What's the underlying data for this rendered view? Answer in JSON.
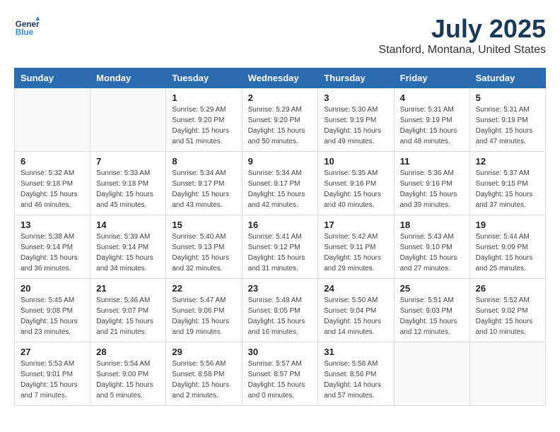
{
  "header": {
    "logo_line1": "General",
    "logo_line2": "Blue",
    "month_year": "July 2025",
    "location": "Stanford, Montana, United States"
  },
  "days_of_week": [
    "Sunday",
    "Monday",
    "Tuesday",
    "Wednesday",
    "Thursday",
    "Friday",
    "Saturday"
  ],
  "weeks": [
    [
      {
        "day": "",
        "sunrise": "",
        "sunset": "",
        "daylight": ""
      },
      {
        "day": "",
        "sunrise": "",
        "sunset": "",
        "daylight": ""
      },
      {
        "day": "1",
        "sunrise": "Sunrise: 5:29 AM",
        "sunset": "Sunset: 9:20 PM",
        "daylight": "Daylight: 15 hours and 51 minutes."
      },
      {
        "day": "2",
        "sunrise": "Sunrise: 5:29 AM",
        "sunset": "Sunset: 9:20 PM",
        "daylight": "Daylight: 15 hours and 50 minutes."
      },
      {
        "day": "3",
        "sunrise": "Sunrise: 5:30 AM",
        "sunset": "Sunset: 9:19 PM",
        "daylight": "Daylight: 15 hours and 49 minutes."
      },
      {
        "day": "4",
        "sunrise": "Sunrise: 5:31 AM",
        "sunset": "Sunset: 9:19 PM",
        "daylight": "Daylight: 15 hours and 48 minutes."
      },
      {
        "day": "5",
        "sunrise": "Sunrise: 5:31 AM",
        "sunset": "Sunset: 9:19 PM",
        "daylight": "Daylight: 15 hours and 47 minutes."
      }
    ],
    [
      {
        "day": "6",
        "sunrise": "Sunrise: 5:32 AM",
        "sunset": "Sunset: 9:18 PM",
        "daylight": "Daylight: 15 hours and 46 minutes."
      },
      {
        "day": "7",
        "sunrise": "Sunrise: 5:33 AM",
        "sunset": "Sunset: 9:18 PM",
        "daylight": "Daylight: 15 hours and 45 minutes."
      },
      {
        "day": "8",
        "sunrise": "Sunrise: 5:34 AM",
        "sunset": "Sunset: 9:17 PM",
        "daylight": "Daylight: 15 hours and 43 minutes."
      },
      {
        "day": "9",
        "sunrise": "Sunrise: 5:34 AM",
        "sunset": "Sunset: 9:17 PM",
        "daylight": "Daylight: 15 hours and 42 minutes."
      },
      {
        "day": "10",
        "sunrise": "Sunrise: 5:35 AM",
        "sunset": "Sunset: 9:16 PM",
        "daylight": "Daylight: 15 hours and 40 minutes."
      },
      {
        "day": "11",
        "sunrise": "Sunrise: 5:36 AM",
        "sunset": "Sunset: 9:16 PM",
        "daylight": "Daylight: 15 hours and 39 minutes."
      },
      {
        "day": "12",
        "sunrise": "Sunrise: 5:37 AM",
        "sunset": "Sunset: 9:15 PM",
        "daylight": "Daylight: 15 hours and 37 minutes."
      }
    ],
    [
      {
        "day": "13",
        "sunrise": "Sunrise: 5:38 AM",
        "sunset": "Sunset: 9:14 PM",
        "daylight": "Daylight: 15 hours and 36 minutes."
      },
      {
        "day": "14",
        "sunrise": "Sunrise: 5:39 AM",
        "sunset": "Sunset: 9:14 PM",
        "daylight": "Daylight: 15 hours and 34 minutes."
      },
      {
        "day": "15",
        "sunrise": "Sunrise: 5:40 AM",
        "sunset": "Sunset: 9:13 PM",
        "daylight": "Daylight: 15 hours and 32 minutes."
      },
      {
        "day": "16",
        "sunrise": "Sunrise: 5:41 AM",
        "sunset": "Sunset: 9:12 PM",
        "daylight": "Daylight: 15 hours and 31 minutes."
      },
      {
        "day": "17",
        "sunrise": "Sunrise: 5:42 AM",
        "sunset": "Sunset: 9:11 PM",
        "daylight": "Daylight: 15 hours and 29 minutes."
      },
      {
        "day": "18",
        "sunrise": "Sunrise: 5:43 AM",
        "sunset": "Sunset: 9:10 PM",
        "daylight": "Daylight: 15 hours and 27 minutes."
      },
      {
        "day": "19",
        "sunrise": "Sunrise: 5:44 AM",
        "sunset": "Sunset: 9:09 PM",
        "daylight": "Daylight: 15 hours and 25 minutes."
      }
    ],
    [
      {
        "day": "20",
        "sunrise": "Sunrise: 5:45 AM",
        "sunset": "Sunset: 9:08 PM",
        "daylight": "Daylight: 15 hours and 23 minutes."
      },
      {
        "day": "21",
        "sunrise": "Sunrise: 5:46 AM",
        "sunset": "Sunset: 9:07 PM",
        "daylight": "Daylight: 15 hours and 21 minutes."
      },
      {
        "day": "22",
        "sunrise": "Sunrise: 5:47 AM",
        "sunset": "Sunset: 9:06 PM",
        "daylight": "Daylight: 15 hours and 19 minutes."
      },
      {
        "day": "23",
        "sunrise": "Sunrise: 5:48 AM",
        "sunset": "Sunset: 9:05 PM",
        "daylight": "Daylight: 15 hours and 16 minutes."
      },
      {
        "day": "24",
        "sunrise": "Sunrise: 5:50 AM",
        "sunset": "Sunset: 9:04 PM",
        "daylight": "Daylight: 15 hours and 14 minutes."
      },
      {
        "day": "25",
        "sunrise": "Sunrise: 5:51 AM",
        "sunset": "Sunset: 9:03 PM",
        "daylight": "Daylight: 15 hours and 12 minutes."
      },
      {
        "day": "26",
        "sunrise": "Sunrise: 5:52 AM",
        "sunset": "Sunset: 9:02 PM",
        "daylight": "Daylight: 15 hours and 10 minutes."
      }
    ],
    [
      {
        "day": "27",
        "sunrise": "Sunrise: 5:53 AM",
        "sunset": "Sunset: 9:01 PM",
        "daylight": "Daylight: 15 hours and 7 minutes."
      },
      {
        "day": "28",
        "sunrise": "Sunrise: 5:54 AM",
        "sunset": "Sunset: 9:00 PM",
        "daylight": "Daylight: 15 hours and 5 minutes."
      },
      {
        "day": "29",
        "sunrise": "Sunrise: 5:56 AM",
        "sunset": "Sunset: 8:58 PM",
        "daylight": "Daylight: 15 hours and 2 minutes."
      },
      {
        "day": "30",
        "sunrise": "Sunrise: 5:57 AM",
        "sunset": "Sunset: 8:57 PM",
        "daylight": "Daylight: 15 hours and 0 minutes."
      },
      {
        "day": "31",
        "sunrise": "Sunrise: 5:58 AM",
        "sunset": "Sunset: 8:56 PM",
        "daylight": "Daylight: 14 hours and 57 minutes."
      },
      {
        "day": "",
        "sunrise": "",
        "sunset": "",
        "daylight": ""
      },
      {
        "day": "",
        "sunrise": "",
        "sunset": "",
        "daylight": ""
      }
    ]
  ]
}
